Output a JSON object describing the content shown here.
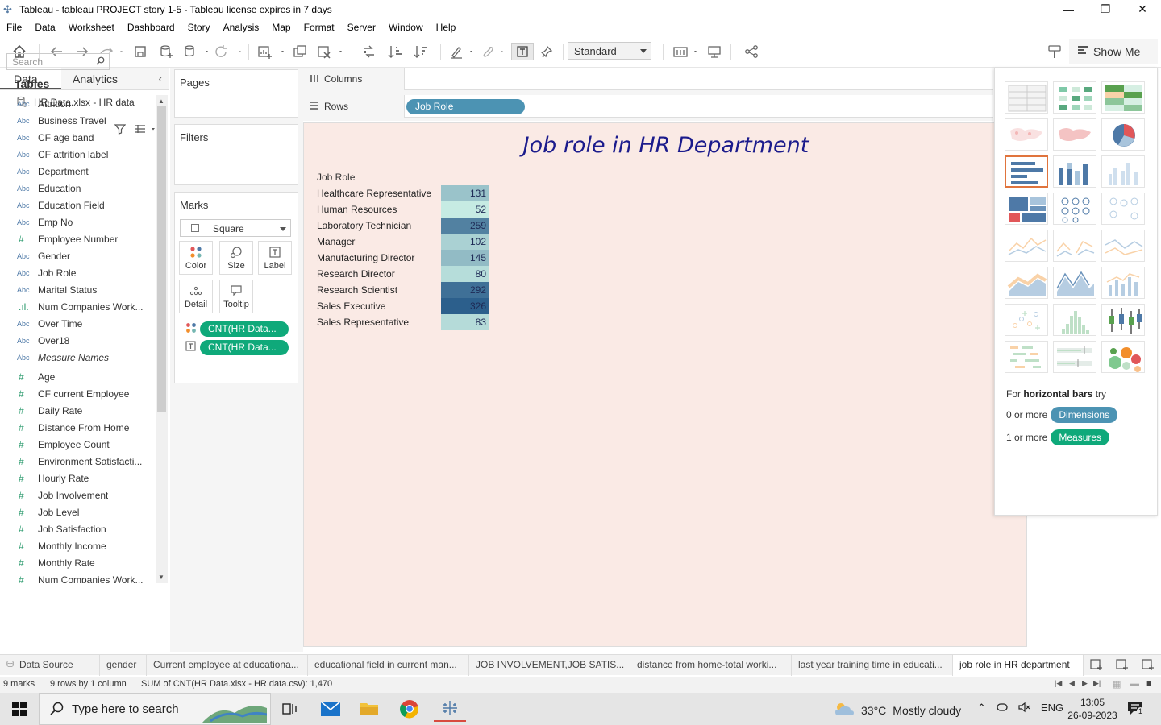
{
  "window": {
    "title": "Tableau - tableau PROJECT story 1-5 - Tableau license expires in 7 days",
    "minimize": "—",
    "maximize": "❐",
    "close": "✕"
  },
  "menu": [
    "File",
    "Data",
    "Worksheet",
    "Dashboard",
    "Story",
    "Analysis",
    "Map",
    "Format",
    "Server",
    "Window",
    "Help"
  ],
  "toolbar": {
    "fit_select": "Standard",
    "show_me_label": "Show Me"
  },
  "data_pane": {
    "tabs": [
      "Data",
      "Analytics"
    ],
    "collapse_icon": "‹",
    "datasource": "HR Data.xlsx - HR data",
    "search_placeholder": "Search",
    "tables_header": "Tables",
    "dimensions": [
      {
        "type": "Abc",
        "name": "Attrition"
      },
      {
        "type": "Abc",
        "name": "Business Travel"
      },
      {
        "type": "Abc",
        "name": "CF age band"
      },
      {
        "type": "Abc",
        "name": "CF attrition label"
      },
      {
        "type": "Abc",
        "name": "Department"
      },
      {
        "type": "Abc",
        "name": "Education"
      },
      {
        "type": "Abc",
        "name": "Education Field"
      },
      {
        "type": "Abc",
        "name": "Emp No"
      },
      {
        "type": "#",
        "name": "Employee Number"
      },
      {
        "type": "Abc",
        "name": "Gender"
      },
      {
        "type": "Abc",
        "name": "Job Role"
      },
      {
        "type": "Abc",
        "name": "Marital Status"
      },
      {
        "type": ".ıl.",
        "name": "Num Companies Work..."
      },
      {
        "type": "Abc",
        "name": "Over Time"
      },
      {
        "type": "Abc",
        "name": "Over18"
      },
      {
        "type": "Abc",
        "name": "Measure Names",
        "italic": true
      }
    ],
    "measures": [
      {
        "type": "#",
        "name": "Age"
      },
      {
        "type": "#",
        "name": "CF current Employee"
      },
      {
        "type": "#",
        "name": "Daily Rate"
      },
      {
        "type": "#",
        "name": "Distance From Home"
      },
      {
        "type": "#",
        "name": "Employee Count"
      },
      {
        "type": "#",
        "name": "Environment Satisfacti..."
      },
      {
        "type": "#",
        "name": "Hourly Rate"
      },
      {
        "type": "#",
        "name": "Job Involvement"
      },
      {
        "type": "#",
        "name": "Job Level"
      },
      {
        "type": "#",
        "name": "Job Satisfaction"
      },
      {
        "type": "#",
        "name": "Monthly Income"
      },
      {
        "type": "#",
        "name": "Monthly Rate"
      },
      {
        "type": "#",
        "name": "Num Companies Work..."
      }
    ]
  },
  "cards": {
    "pages": "Pages",
    "filters": "Filters",
    "marks": "Marks",
    "mark_type": "Square",
    "mark_buttons": [
      "Color",
      "Size",
      "Label",
      "Detail",
      "Tooltip"
    ],
    "mark_pills": [
      "CNT(HR Data...",
      "CNT(HR Data..."
    ]
  },
  "shelves": {
    "columns_label": "Columns",
    "rows_label": "Rows",
    "rows_pill": "Job Role"
  },
  "viz": {
    "title": "Job role in HR Department",
    "column_header": "Job Role",
    "color_scale": {
      "min_color": "#c6ebe3",
      "max_color": "#2c5f8c"
    }
  },
  "chart_data": {
    "type": "table",
    "title": "Job role in HR Department",
    "xlabel": "",
    "ylabel": "Job Role",
    "categories": [
      "Healthcare Representative",
      "Human Resources",
      "Laboratory Technician",
      "Manager",
      "Manufacturing Director",
      "Research Director",
      "Research Scientist",
      "Sales Executive",
      "Sales Representative"
    ],
    "values": [
      131,
      52,
      259,
      102,
      145,
      80,
      292,
      326,
      83
    ]
  },
  "show_me": {
    "hint_prefix": "For",
    "hint_bold": "horizontal bars",
    "hint_suffix": "try",
    "req1_prefix": "0 or more",
    "req1_pill": "Dimensions",
    "req2_prefix": "1 or more",
    "req2_pill": "Measures",
    "tiles": [
      "text-table",
      "heat-map",
      "highlight-table",
      "symbol-map",
      "filled-map",
      "pie-chart",
      "horizontal-bars",
      "stacked-bars",
      "side-by-side-bars",
      "treemap",
      "circle-views",
      "side-by-side-circles",
      "continuous-lines",
      "discrete-lines",
      "dual-lines",
      "area-continuous",
      "area-discrete",
      "dual-combination",
      "scatter-plot",
      "histogram",
      "box-and-whisker",
      "gantt-chart",
      "bullet-graph",
      "packed-bubbles"
    ]
  },
  "sheet_tabs": [
    {
      "label": "Data Source"
    },
    {
      "label": "gender"
    },
    {
      "label": "Current employee at educationa..."
    },
    {
      "label": "educational field in current man..."
    },
    {
      "label": "JOB INVOLVEMENT,JOB SATIS..."
    },
    {
      "label": "distance from home-total worki..."
    },
    {
      "label": "last year training time in educati..."
    },
    {
      "label": "job role in HR department",
      "active": true
    }
  ],
  "status": {
    "marks": "9 marks",
    "rows_cols": "9 rows by 1 column",
    "sum": "SUM of CNT(HR Data.xlsx - HR data.csv): 1,470"
  },
  "taskbar": {
    "search_placeholder": "Type here to search",
    "weather_temp": "33°C",
    "weather_desc": "Mostly cloudy",
    "lang": "ENG",
    "time": "13:05",
    "date": "26-09-2023",
    "notif_count": "1"
  }
}
